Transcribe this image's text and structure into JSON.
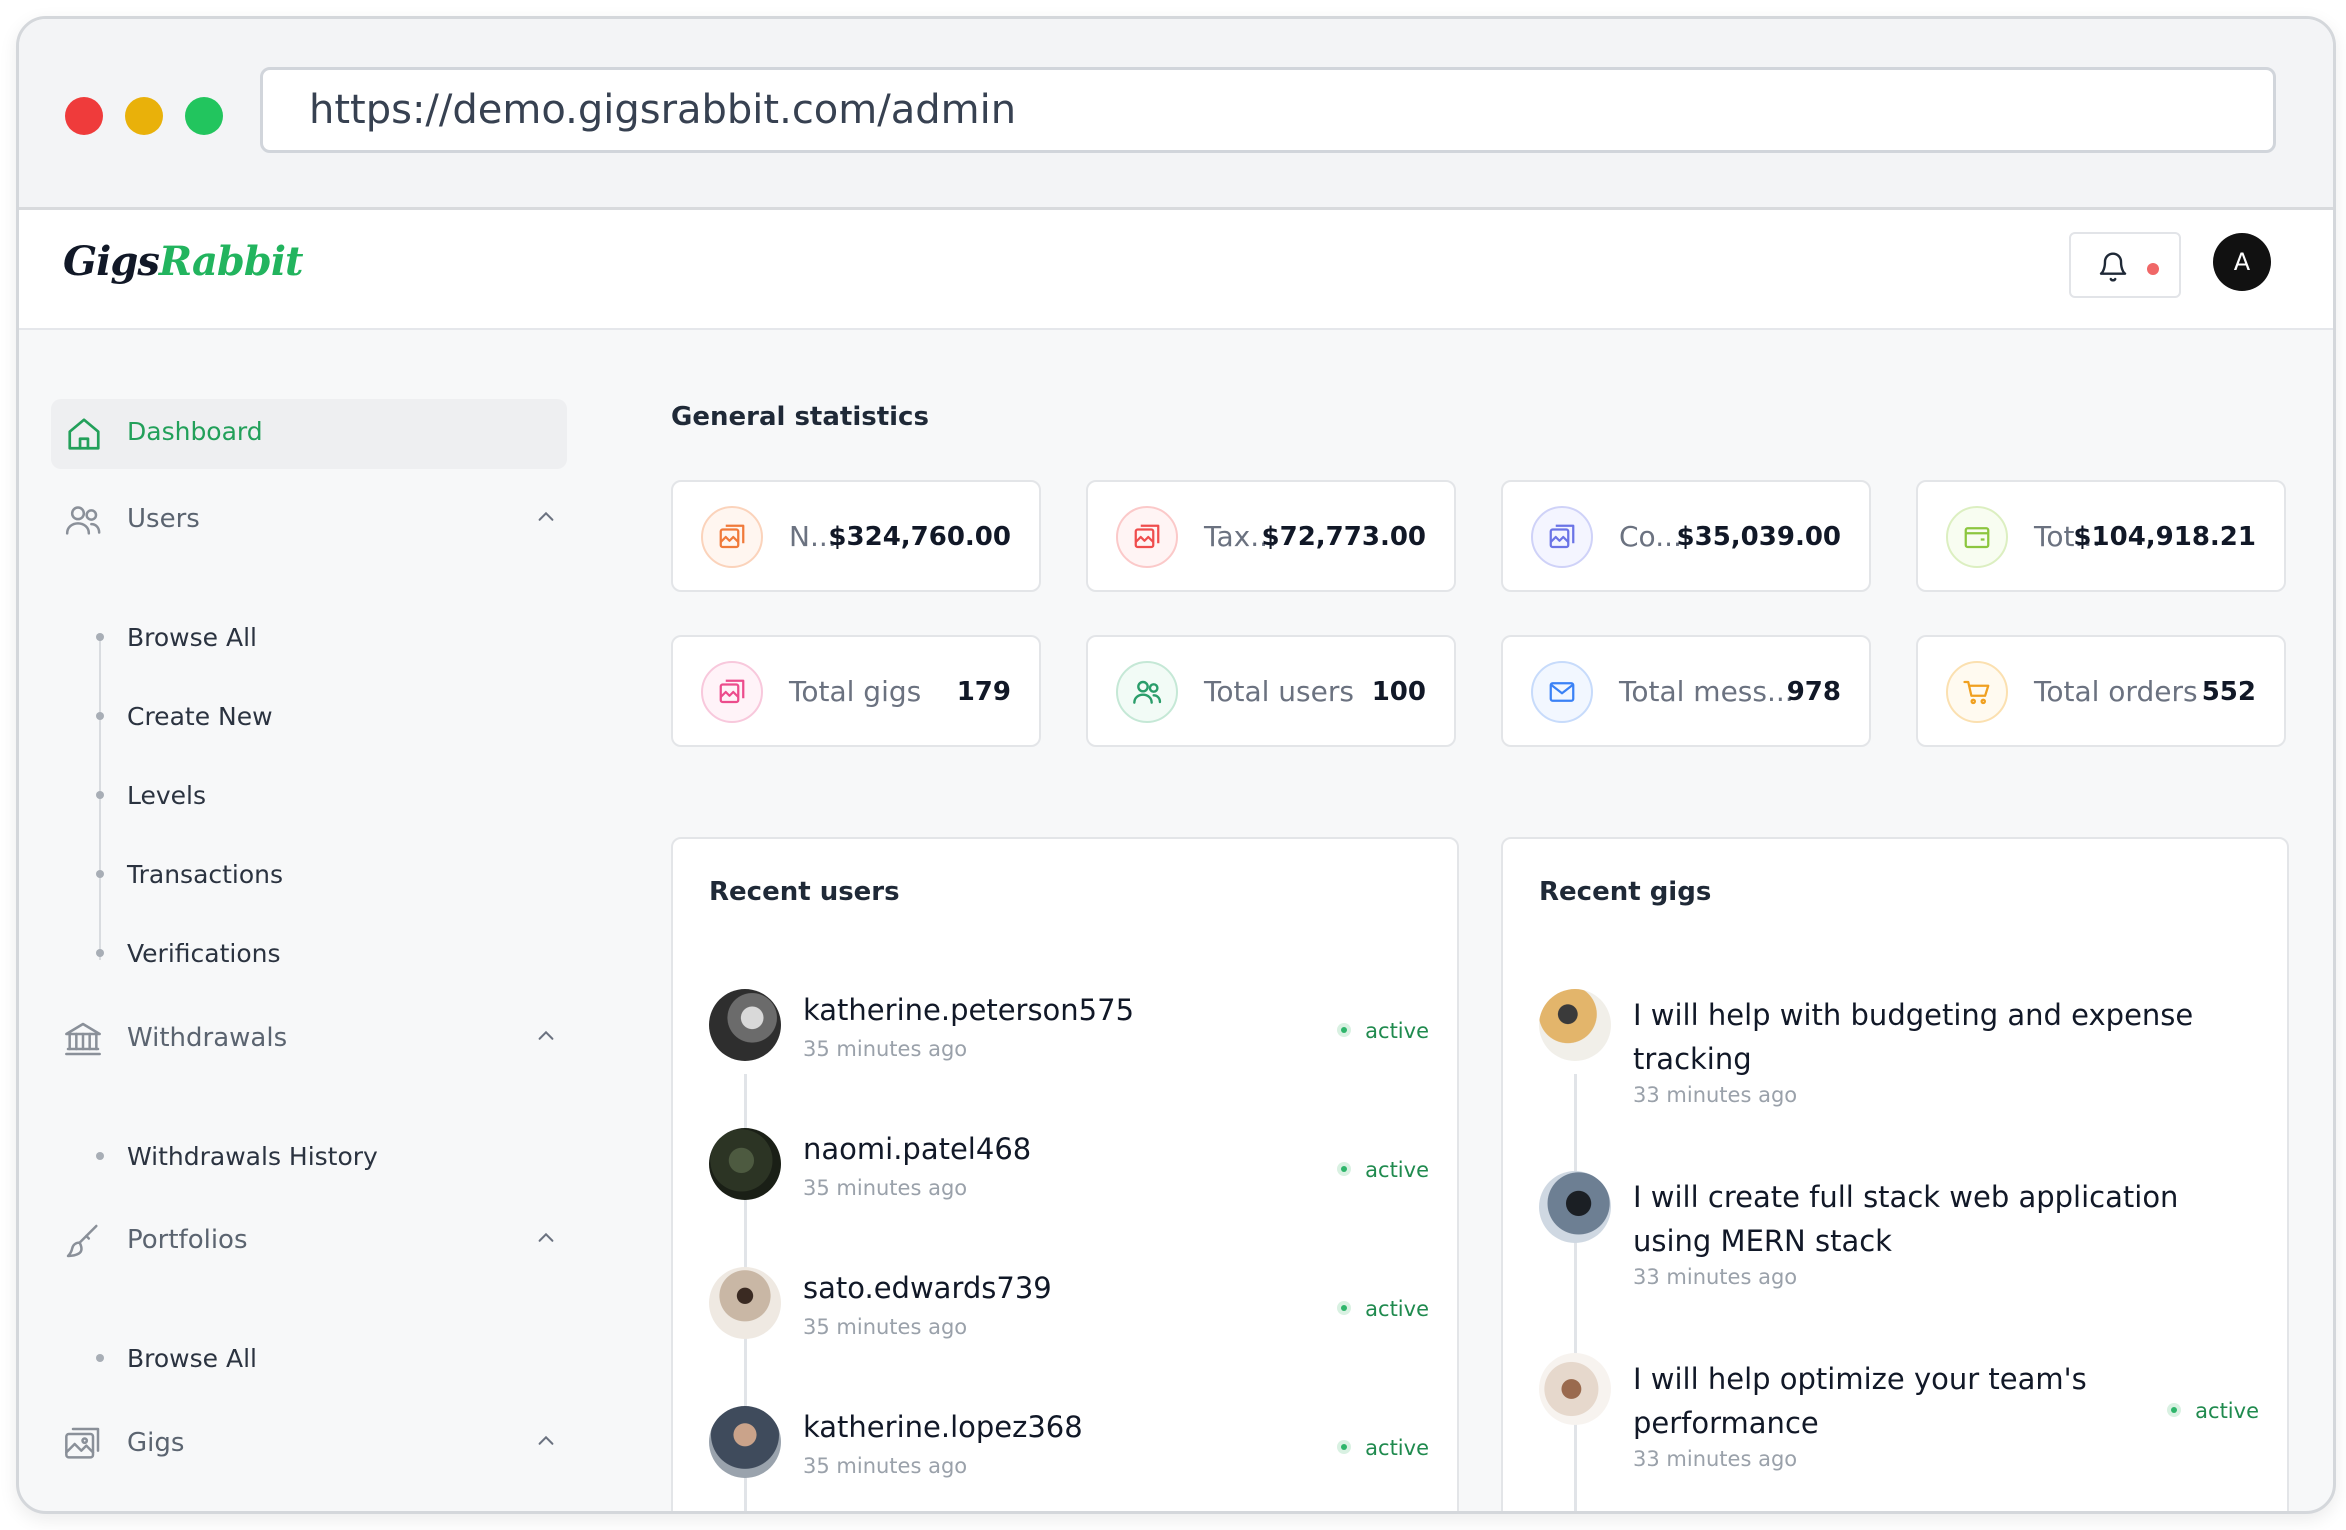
{
  "browser": {
    "url": "https://demo.gigsrabbit.com/admin"
  },
  "header": {
    "logo_part1": "Gigs",
    "logo_part2": "Rabbit",
    "avatar_initial": "A"
  },
  "sidebar": {
    "active": {
      "label": "Dashboard",
      "icon": "home-icon"
    },
    "groups": [
      {
        "label": "Users",
        "icon": "users-icon",
        "items": [
          "Browse All",
          "Create New",
          "Levels",
          "Transactions",
          "Verifications"
        ]
      },
      {
        "label": "Withdrawals",
        "icon": "bank-icon",
        "items": [
          "Withdrawals History"
        ]
      },
      {
        "label": "Portfolios",
        "icon": "brush-icon",
        "items": [
          "Browse All"
        ]
      },
      {
        "label": "Gigs",
        "icon": "gallery-icon",
        "items": []
      }
    ]
  },
  "main": {
    "section_title": "General statistics",
    "stats": [
      {
        "label": "N...",
        "value": "$324,760.00",
        "color": "#f07a3a",
        "icon": "image-icon"
      },
      {
        "label": "Tax...",
        "value": "$72,773.00",
        "color": "#ef4d4d",
        "icon": "image-icon"
      },
      {
        "label": "Co...",
        "value": "$35,039.00",
        "color": "#6b74e6",
        "icon": "image-icon"
      },
      {
        "label": "Tot...",
        "value": "$104,918.21",
        "color": "#8cc63f",
        "icon": "wallet-icon"
      },
      {
        "label": "Total gigs",
        "value": "179",
        "color": "#ec4c8c",
        "icon": "image-icon"
      },
      {
        "label": "Total users",
        "value": "100",
        "color": "#2a9d6a",
        "icon": "users-icon"
      },
      {
        "label": "Total mess...",
        "value": "978",
        "color": "#3b82f6",
        "icon": "mail-icon"
      },
      {
        "label": "Total orders",
        "value": "552",
        "color": "#f0a020",
        "icon": "cart-icon"
      }
    ],
    "recent_users": {
      "title": "Recent users",
      "items": [
        {
          "name": "katherine.peterson575",
          "time": "35 minutes ago",
          "status": "active"
        },
        {
          "name": "naomi.patel468",
          "time": "35 minutes ago",
          "status": "active"
        },
        {
          "name": "sato.edwards739",
          "time": "35 minutes ago",
          "status": "active"
        },
        {
          "name": "katherine.lopez368",
          "time": "35 minutes ago",
          "status": "active"
        }
      ]
    },
    "recent_gigs": {
      "title": "Recent gigs",
      "items": [
        {
          "title": "I will help with budgeting and expense tracking",
          "time": "33 minutes ago",
          "status": ""
        },
        {
          "title": "I will create full stack web application using MERN stack",
          "time": "33 minutes ago",
          "status": ""
        },
        {
          "title": "I will help optimize your team's performance",
          "time": "33 minutes ago",
          "status": "active"
        }
      ]
    }
  },
  "colors": {
    "accent": "#22a05a",
    "status_active": "#1f8a4e",
    "notification_dot": "#f06767"
  }
}
